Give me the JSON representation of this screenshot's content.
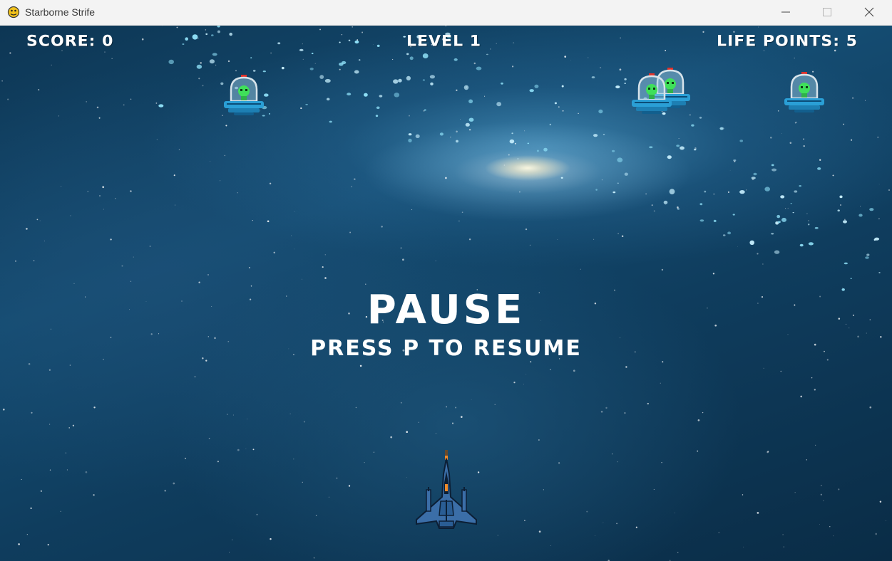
{
  "window": {
    "title": "Starborne Strife",
    "icon": "pygame-snake-icon",
    "controls": [
      "minimize-icon",
      "maximize-icon",
      "close-icon"
    ]
  },
  "hud": {
    "score_label": "SCORE: 0",
    "level_label": "LEVEL 1",
    "lives_label": "LIFE POINTS: 5"
  },
  "pause_overlay": {
    "title": "PAUSE",
    "subtitle": "PRESS P TO RESUME"
  },
  "sprites": {
    "enemy_icon": "alien-ufo-icon",
    "enemy_count": 4,
    "player_icon": "player-jet-icon"
  },
  "colors": {
    "background": "#154d73",
    "hud_text": "#ffffff",
    "ufo_body": "#2a9fd6",
    "alien": "#3fe05a",
    "jet": "#3b6ea8"
  }
}
